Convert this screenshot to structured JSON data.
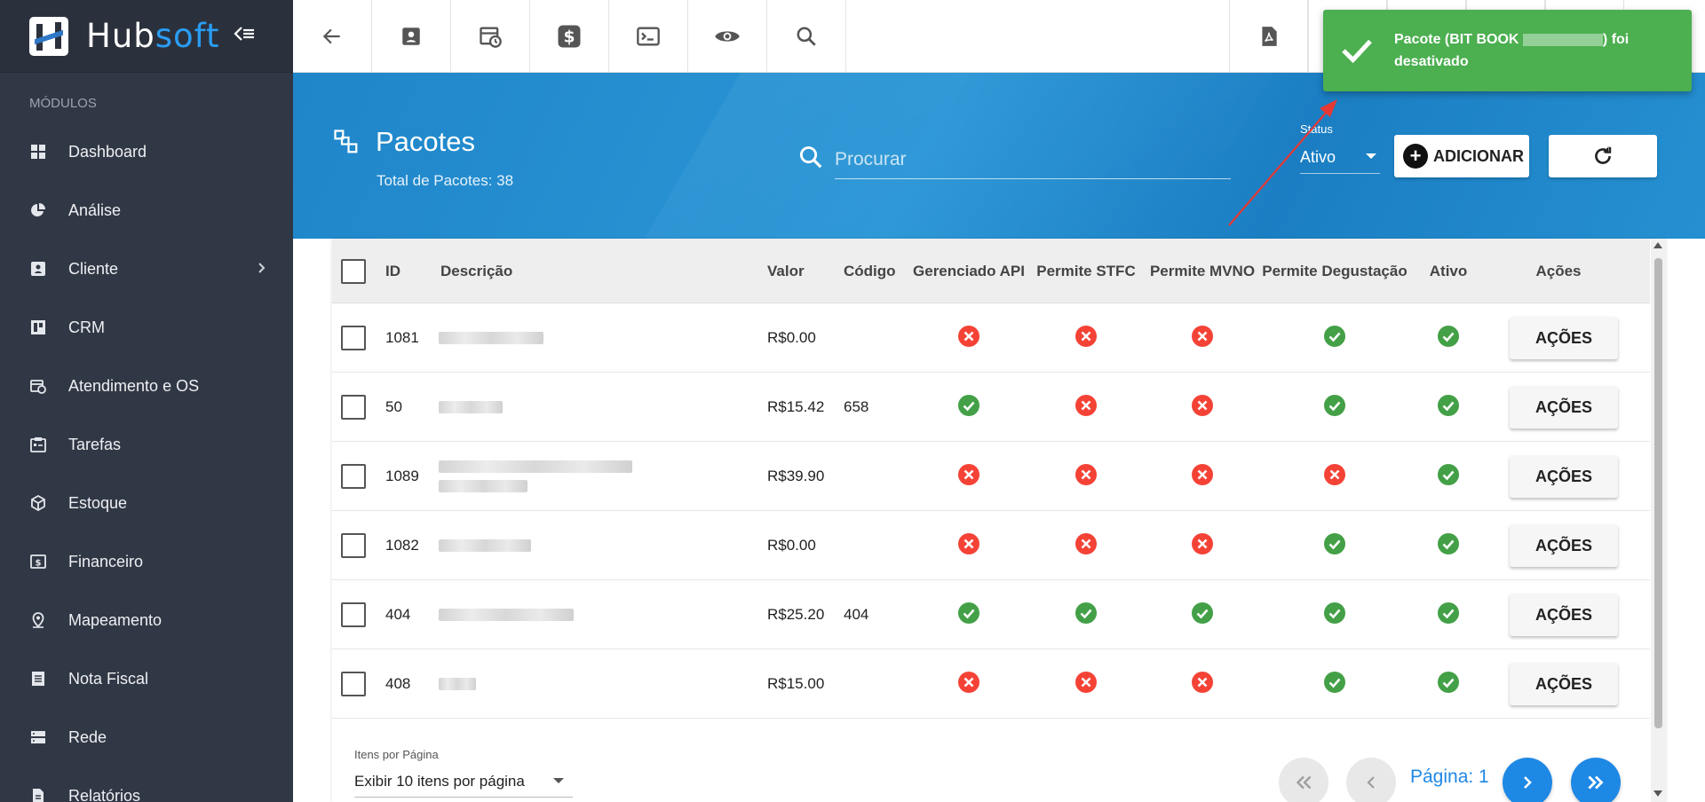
{
  "app": {
    "name_part1": "Hub",
    "name_part2": "soft"
  },
  "sidebar": {
    "section_title": "MÓDULOS",
    "items": [
      {
        "label": "Dashboard",
        "icon": "dashboard-icon"
      },
      {
        "label": "Análise",
        "icon": "pie-chart-icon"
      },
      {
        "label": "Cliente",
        "icon": "contact-card-icon",
        "has_submenu": true
      },
      {
        "label": "CRM",
        "icon": "board-icon"
      },
      {
        "label": "Atendimento e OS",
        "icon": "calendar-clock-icon"
      },
      {
        "label": "Tarefas",
        "icon": "tasks-icon"
      },
      {
        "label": "Estoque",
        "icon": "box-icon"
      },
      {
        "label": "Financeiro",
        "icon": "money-icon"
      },
      {
        "label": "Mapeamento",
        "icon": "map-pin-icon"
      },
      {
        "label": "Nota Fiscal",
        "icon": "document-icon"
      },
      {
        "label": "Rede",
        "icon": "server-icon"
      },
      {
        "label": "Relatórios",
        "icon": "report-icon"
      }
    ]
  },
  "header": {
    "title": "Pacotes",
    "total_label": "Total de Pacotes: 38",
    "search_placeholder": "Procurar",
    "status_label": "Status",
    "status_value": "Ativo",
    "add_label": "ADICIONAR"
  },
  "table": {
    "columns": [
      "ID",
      "Descrição",
      "Valor",
      "Código",
      "Gerenciado API",
      "Permite STFC",
      "Permite MVNO",
      "Permite Degustação",
      "Ativo",
      "Ações"
    ],
    "action_label": "AÇÕES",
    "rows": [
      {
        "id": "1081",
        "valor": "R$0.00",
        "codigo": "",
        "flags": [
          false,
          false,
          false,
          true,
          true
        ]
      },
      {
        "id": "50",
        "valor": "R$15.42",
        "codigo": "658",
        "flags": [
          true,
          false,
          false,
          true,
          true
        ]
      },
      {
        "id": "1089",
        "valor": "R$39.90",
        "codigo": "",
        "flags": [
          false,
          false,
          false,
          false,
          true
        ]
      },
      {
        "id": "1082",
        "valor": "R$0.00",
        "codigo": "",
        "flags": [
          false,
          false,
          false,
          true,
          true
        ]
      },
      {
        "id": "404",
        "valor": "R$25.20",
        "codigo": "404",
        "flags": [
          true,
          true,
          true,
          true,
          true
        ]
      },
      {
        "id": "408",
        "valor": "R$15.00",
        "codigo": "",
        "flags": [
          false,
          false,
          false,
          true,
          true
        ]
      }
    ]
  },
  "pagination": {
    "items_label": "Itens por Página",
    "items_value": "Exibir 10 itens por página",
    "page_label": "Página: 1"
  },
  "toast": {
    "text_before": "Pacote (BIT BOOK",
    "text_after": ") foi desativado"
  },
  "colors": {
    "sidebar": "#313845",
    "accent": "#1e88e5",
    "success": "#4caf50",
    "error": "#f44336"
  }
}
